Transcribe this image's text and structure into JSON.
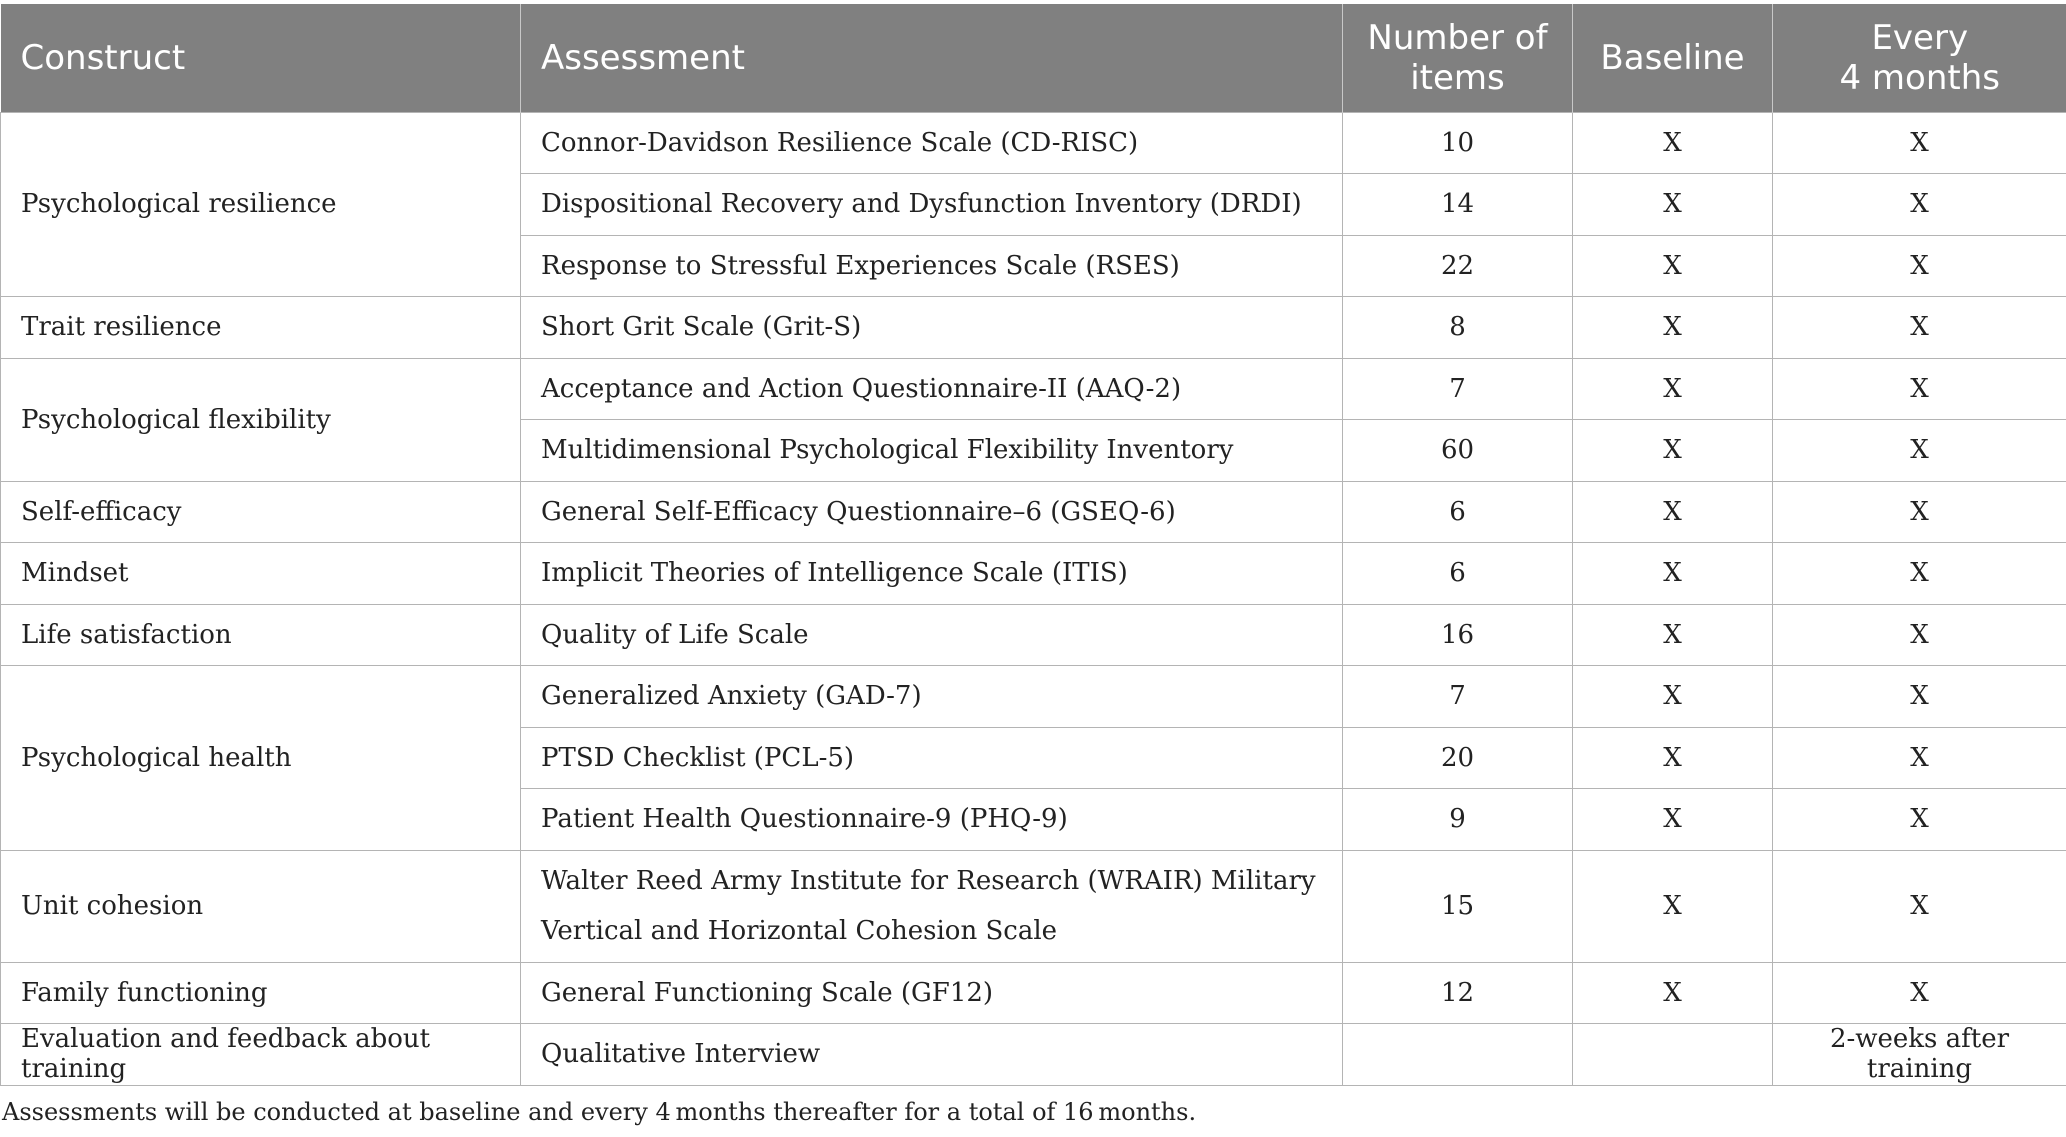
{
  "headers": {
    "construct": "Construct",
    "assessment": "Assessment",
    "items_line1": "Number of",
    "items_line2": "items",
    "baseline": "Baseline",
    "every_line1": "Every",
    "every_line2": "4 months"
  },
  "rows": [
    {
      "construct": "Psychological resilience",
      "assessment": "Connor-Davidson Resilience Scale (CD-RISC)",
      "items": "10",
      "baseline": "X",
      "every4": "X"
    },
    {
      "assessment": "Dispositional Recovery and Dysfunction Inventory (DRDI)",
      "items": "14",
      "baseline": "X",
      "every4": "X"
    },
    {
      "assessment": "Response to Stressful Experiences Scale (RSES)",
      "items": "22",
      "baseline": "X",
      "every4": "X"
    },
    {
      "construct": "Trait resilience",
      "assessment": "Short Grit Scale (Grit-S)",
      "items": "8",
      "baseline": "X",
      "every4": "X"
    },
    {
      "construct": "Psychological flexibility",
      "assessment": "Acceptance and Action Questionnaire-II (AAQ-2)",
      "items": "7",
      "baseline": "X",
      "every4": "X"
    },
    {
      "assessment": "Multidimensional Psychological Flexibility Inventory",
      "items": "60",
      "baseline": "X",
      "every4": "X"
    },
    {
      "construct": "Self-efficacy",
      "assessment": "General Self-Efficacy Questionnaire–6 (GSEQ-6)",
      "items": "6",
      "baseline": "X",
      "every4": "X"
    },
    {
      "construct": "Mindset",
      "assessment": "Implicit Theories of Intelligence Scale (ITIS)",
      "items": "6",
      "baseline": "X",
      "every4": "X"
    },
    {
      "construct": "Life satisfaction",
      "assessment": "Quality of Life Scale",
      "items": "16",
      "baseline": "X",
      "every4": "X"
    },
    {
      "construct": "Psychological health",
      "assessment": "Generalized Anxiety (GAD-7)",
      "items": "7",
      "baseline": "X",
      "every4": "X"
    },
    {
      "assessment": "PTSD Checklist (PCL-5)",
      "items": "20",
      "baseline": "X",
      "every4": "X"
    },
    {
      "assessment": "Patient Health Questionnaire-9 (PHQ-9)",
      "items": "9",
      "baseline": "X",
      "every4": "X"
    },
    {
      "construct": "Unit cohesion",
      "assessment_line1": "Walter Reed Army Institute for Research (WRAIR) Military",
      "assessment_line2": "Vertical and Horizontal Cohesion Scale",
      "items": "15",
      "baseline": "X",
      "every4": "X"
    },
    {
      "construct": "Family functioning",
      "assessment": "General Functioning Scale (GF12)",
      "items": "12",
      "baseline": "X",
      "every4": "X"
    },
    {
      "construct": "Evaluation and feedback about training",
      "assessment": "Qualitative Interview",
      "items": "",
      "baseline": "",
      "every4": "2-weeks after training"
    }
  ],
  "footnote": "Assessments will be conducted at baseline and every 4 months thereafter for a total of 16 months.",
  "colors": {
    "header_bg": "#808080",
    "header_text": "#ffffff",
    "border": "#b4b4b4"
  }
}
